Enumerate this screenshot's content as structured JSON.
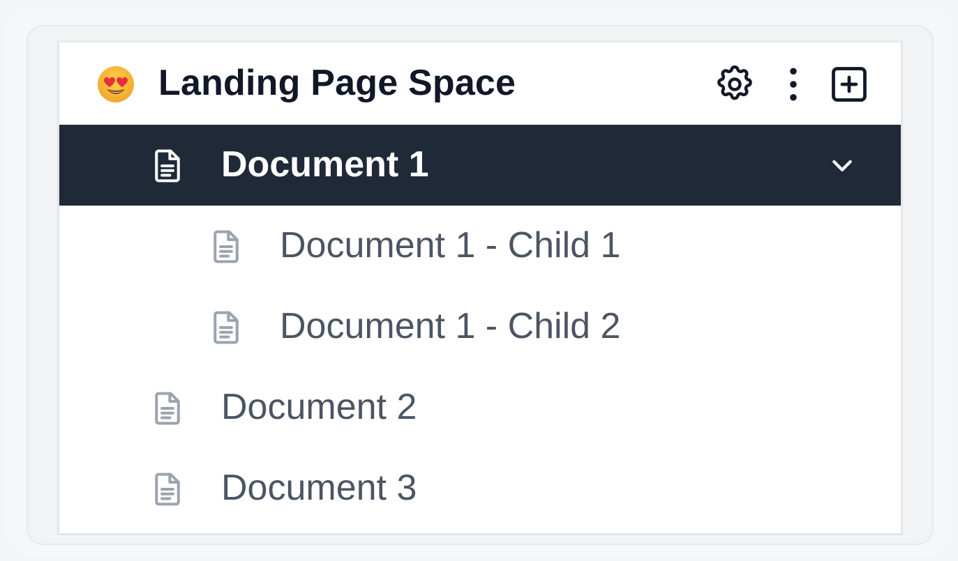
{
  "space": {
    "title": "Landing Page Space",
    "emoji_icon": "heart-eyes-emoji",
    "actions": [
      {
        "name": "settings",
        "icon": "gear-icon"
      },
      {
        "name": "more",
        "icon": "kebab-menu-icon"
      },
      {
        "name": "add",
        "icon": "plus-square-icon"
      }
    ]
  },
  "documents": [
    {
      "label": "Document 1",
      "selected": true,
      "level": 0,
      "icon": "document-icon",
      "expanded": true
    },
    {
      "label": "Document 1 - Child 1",
      "selected": false,
      "level": 1,
      "icon": "document-icon"
    },
    {
      "label": "Document 1 - Child 2",
      "selected": false,
      "level": 1,
      "icon": "document-icon"
    },
    {
      "label": "Document 2",
      "selected": false,
      "level": 0,
      "icon": "document-icon"
    },
    {
      "label": "Document 3",
      "selected": false,
      "level": 0,
      "icon": "document-icon"
    }
  ],
  "colors": {
    "selected_background": "#1f2937",
    "selected_text": "#ffffff",
    "item_text": "#4b5563",
    "icon_muted": "#9ca3af"
  }
}
